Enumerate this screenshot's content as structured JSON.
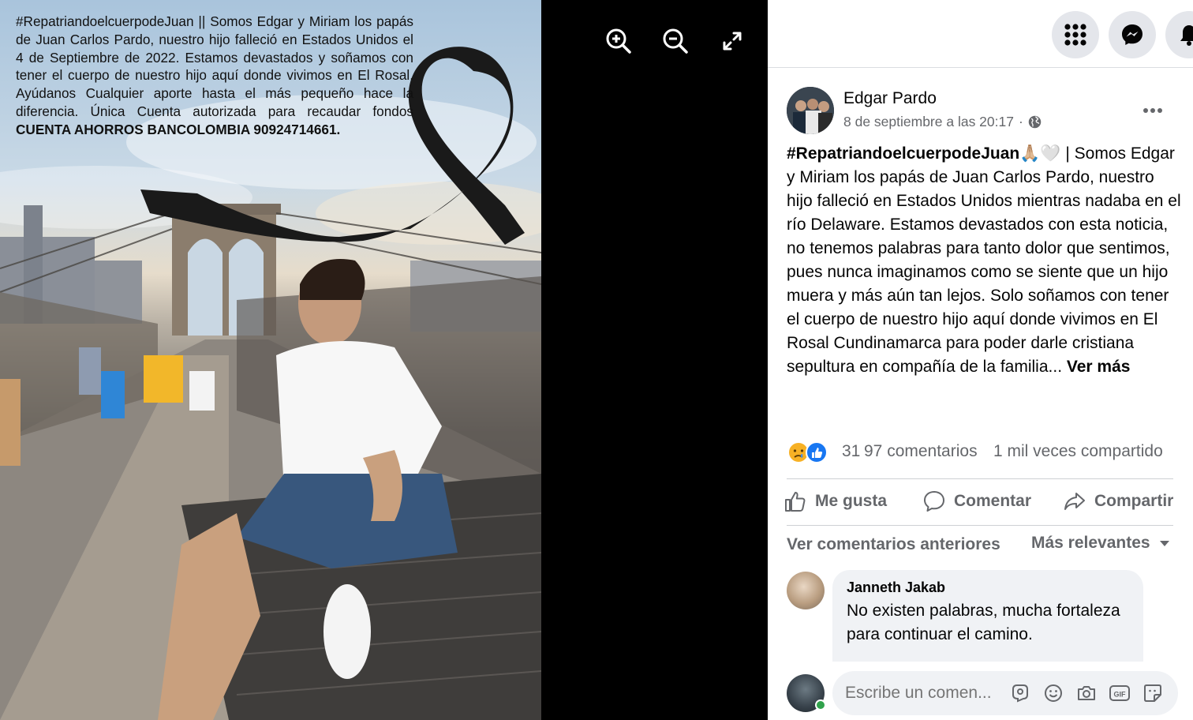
{
  "photo": {
    "caption_normal": "#RepatriandoelcuerpodeJuan || Somos Edgar y Miriam los papás de Juan Carlos Pardo, nuestro hijo falleció en Estados Unidos el 4 de Septiembre de 2022. Estamos devastados y soñamos con tener el cuerpo de nuestro hijo aquí donde vivimos en El Rosal. Ayúdanos Cualquier aporte hasta el más pequeño hace la diferencia. Única Cuenta autorizada para recaudar fondos ",
    "caption_bold": "CUENTA AHORROS BANCOLOMBIA 90924714661."
  },
  "viewer": {
    "zoom_in_icon": "zoom-in-icon",
    "zoom_out_icon": "zoom-out-icon",
    "fullscreen_icon": "fullscreen-icon"
  },
  "topbar": {
    "menu_icon": "grid-menu-icon",
    "messenger_icon": "messenger-icon",
    "notifications_icon": "bell-icon"
  },
  "post": {
    "author": "Edgar Pardo",
    "timestamp": "8 de septiembre a las 20:17",
    "privacy_separator": "·",
    "hashtag": "#RepatriandoelcuerpodeJuan🙏🏼🤍",
    "body": " | Somos Edgar y Miriam los papás de Juan Carlos Pardo, nuestro hijo falleció en Estados Unidos mientras nadaba en el río Delaware. Estamos devastados con esta noticia, no tenemos palabras para tanto dolor que sentimos, pues nunca imaginamos como se siente que un hijo muera y más aún tan lejos. Solo soñamos con tener el cuerpo de nuestro hijo aquí donde vivimos en El Rosal Cundinamarca para poder darle cristiana sepultura en compañía de la familia... ",
    "see_more": "Ver más"
  },
  "stats": {
    "reaction_count": "31",
    "comments": "97 comentarios",
    "shares": "1 mil veces compartido"
  },
  "actions": {
    "like": "Me gusta",
    "comment": "Comentar",
    "share": "Compartir"
  },
  "comments": {
    "view_previous": "Ver comentarios anteriores",
    "sort_label": "Más relevantes",
    "items": [
      {
        "author": "Janneth Jakab",
        "text": "No existen palabras, mucha fortaleza para continuar el camino."
      }
    ]
  },
  "composer": {
    "placeholder": "Escribe un comen..."
  },
  "colors": {
    "facebook_blue": "#1877f2",
    "secondary_text": "#65676b",
    "background_gray": "#f0f2f5"
  }
}
